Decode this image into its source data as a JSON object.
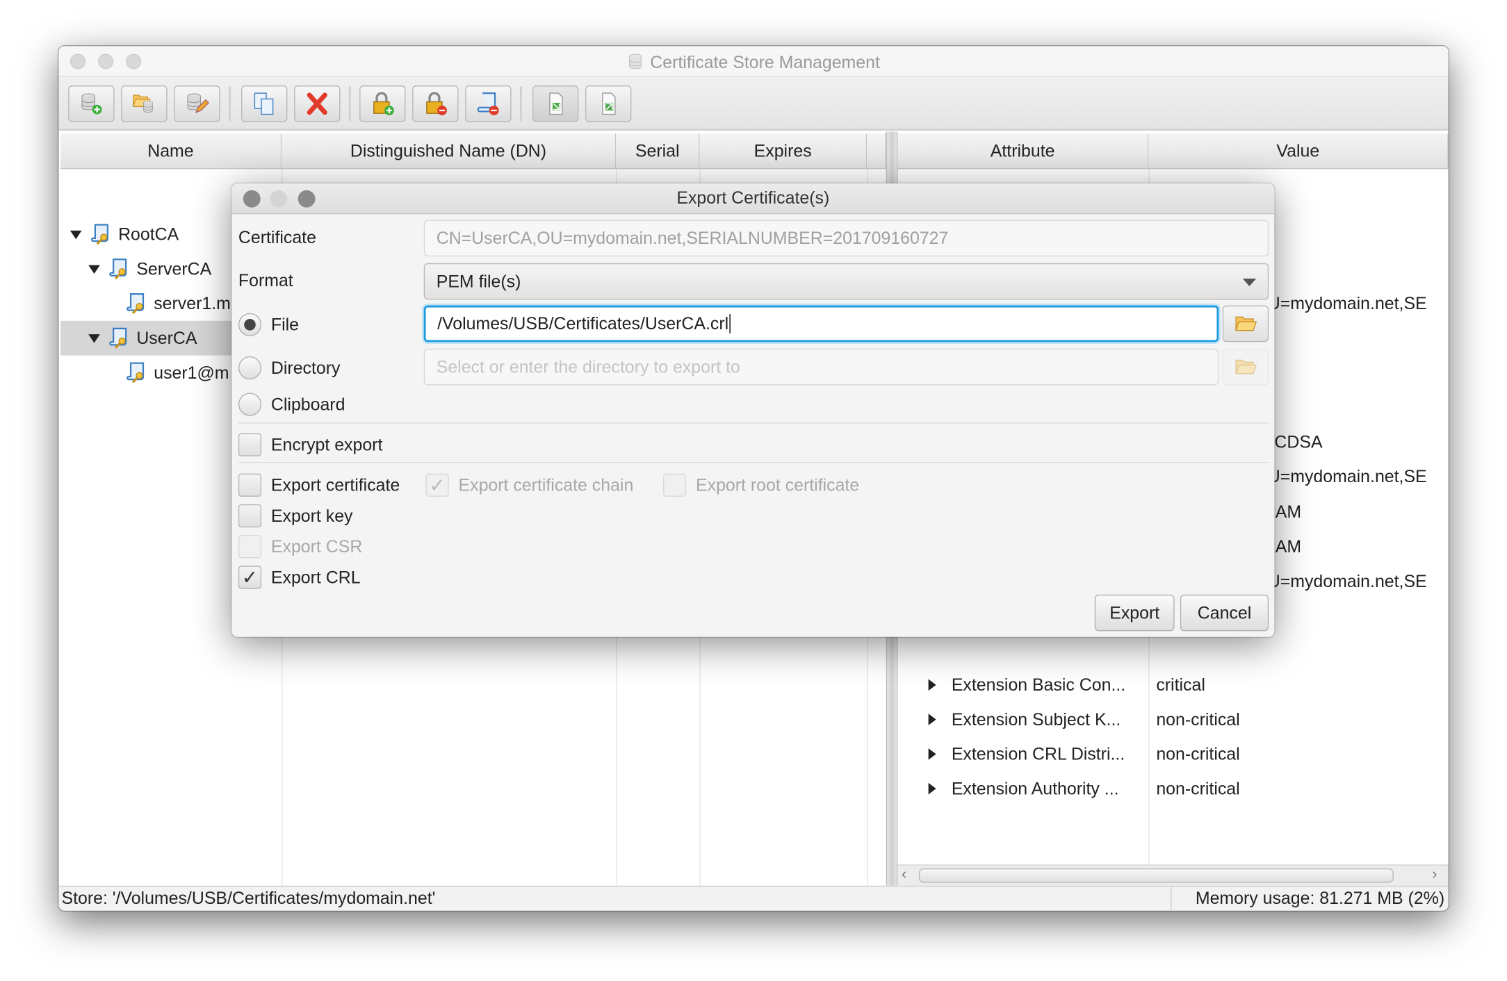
{
  "window": {
    "title": "Certificate Store Management",
    "title_icon": "database-icon"
  },
  "toolbar": {
    "buttons": [
      {
        "name": "new-store-button",
        "icon": "database-add-icon"
      },
      {
        "name": "open-store-button",
        "icon": "folder-database-icon"
      },
      {
        "name": "edit-store-button",
        "icon": "database-edit-icon"
      },
      {
        "name": "copy-button",
        "icon": "copy-icon"
      },
      {
        "name": "delete-button",
        "icon": "delete-x-icon"
      },
      {
        "name": "add-key-button",
        "icon": "lock-add-icon"
      },
      {
        "name": "remove-key-button",
        "icon": "lock-remove-icon"
      },
      {
        "name": "remove-certificate-button",
        "icon": "certificate-remove-icon"
      },
      {
        "name": "import-button",
        "icon": "import-icon"
      },
      {
        "name": "export-button",
        "icon": "export-icon"
      }
    ]
  },
  "store_table": {
    "columns": [
      "Name",
      "Distinguished Name (DN)",
      "Serial",
      "Expires"
    ],
    "rows": [
      {
        "name": "RootCA",
        "level": 0,
        "expanded": true
      },
      {
        "name": "ServerCA",
        "level": 1,
        "expanded": true
      },
      {
        "name": "server1.m",
        "level": 2
      },
      {
        "name": "UserCA",
        "level": 1,
        "expanded": true,
        "selected": true
      },
      {
        "name": "user1@m",
        "level": 2
      }
    ]
  },
  "details_table": {
    "columns": [
      "Attribute",
      "Value"
    ],
    "visible_value_fragments": [
      "U=mydomain.net,SE",
      "CDSA",
      "U=mydomain.net,SE",
      "AM",
      "AM",
      "U=mydomain.net,SE"
    ],
    "extension_rows": [
      {
        "attribute": "Extension Basic Con...",
        "value": "critical"
      },
      {
        "attribute": "Extension Subject K...",
        "value": "non-critical"
      },
      {
        "attribute": "Extension CRL Distri...",
        "value": "non-critical"
      },
      {
        "attribute": "Extension Authority ...",
        "value": "non-critical"
      }
    ]
  },
  "status": {
    "store": "Store: '/Volumes/USB/Certificates/mydomain.net'",
    "memory": "Memory usage: 81.271 MB (2%)"
  },
  "dialog": {
    "title": "Export Certificate(s)",
    "certificate_label": "Certificate",
    "certificate_value": "CN=UserCA,OU=mydomain.net,SERIALNUMBER=201709160727",
    "format_label": "Format",
    "format_value": "PEM file(s)",
    "target": {
      "selected": "File",
      "file_label": "File",
      "file_value": "/Volumes/USB/Certificates/UserCA.crl",
      "directory_label": "Directory",
      "directory_placeholder": "Select or enter the directory to export to",
      "clipboard_label": "Clipboard"
    },
    "options": {
      "encrypt_export": {
        "label": "Encrypt export",
        "checked": false
      },
      "export_certificate": {
        "label": "Export certificate",
        "checked": false
      },
      "export_certificate_chain": {
        "label": "Export certificate chain",
        "checked": true,
        "disabled": true
      },
      "export_root_certificate": {
        "label": "Export root certificate",
        "checked": false,
        "disabled": true
      },
      "export_key": {
        "label": "Export key",
        "checked": false
      },
      "export_csr": {
        "label": "Export CSR",
        "checked": false,
        "disabled": true
      },
      "export_crl": {
        "label": "Export CRL",
        "checked": true
      }
    },
    "export_label": "Export",
    "cancel_label": "Cancel"
  },
  "colors": {
    "focus": "#1e9be0",
    "selection": "#d6d6d6",
    "folder": "#f0b840"
  }
}
